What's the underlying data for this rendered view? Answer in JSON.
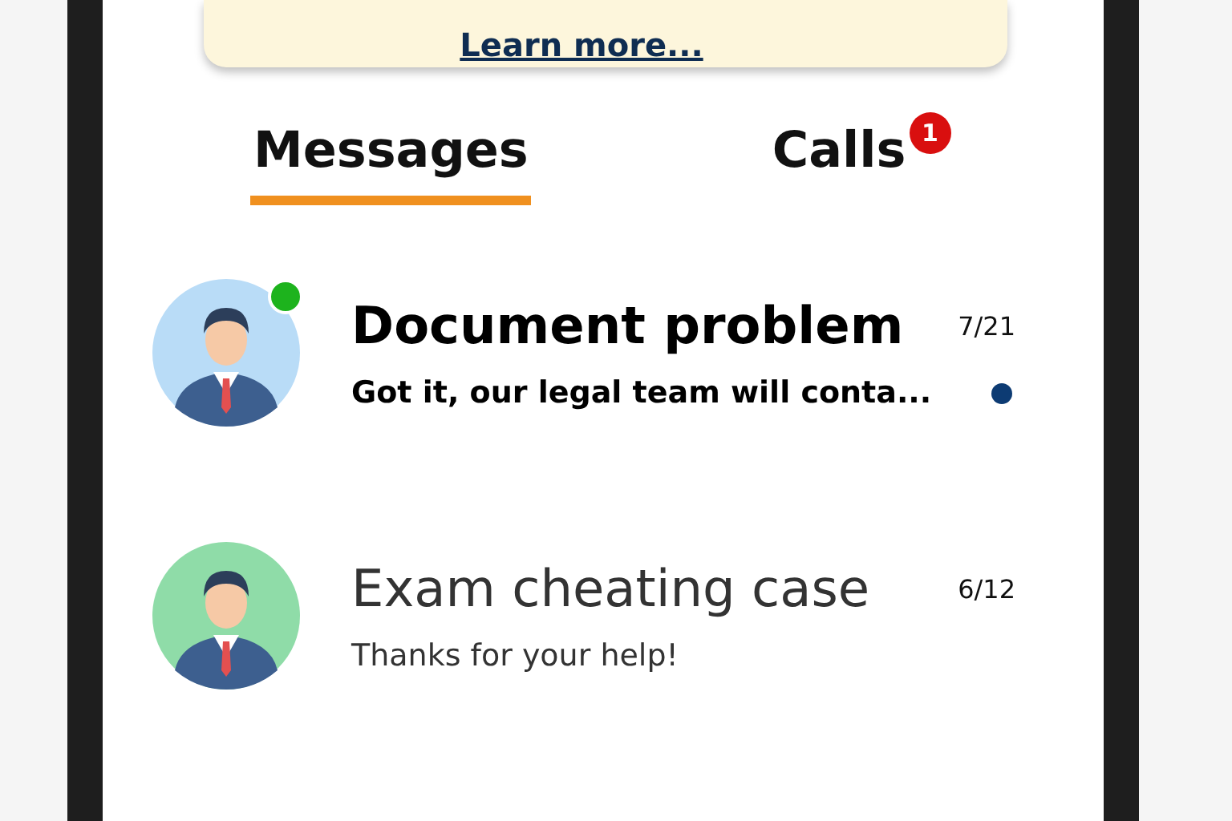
{
  "banner": {
    "link": "Learn more..."
  },
  "tabs": [
    {
      "label": "Messages",
      "selected": true
    },
    {
      "label": "Calls",
      "selected": false,
      "badge": "1"
    }
  ],
  "conversations": [
    {
      "title": "Document problem",
      "date": "7/21",
      "preview": "Got it, our legal team will conta...",
      "unread": true,
      "online": true,
      "color": "#b9dcf7"
    },
    {
      "title": "Exam cheating case",
      "date": "6/12",
      "preview": "Thanks for your help!",
      "unread": false,
      "online": false,
      "color": "#8fdca8"
    }
  ]
}
